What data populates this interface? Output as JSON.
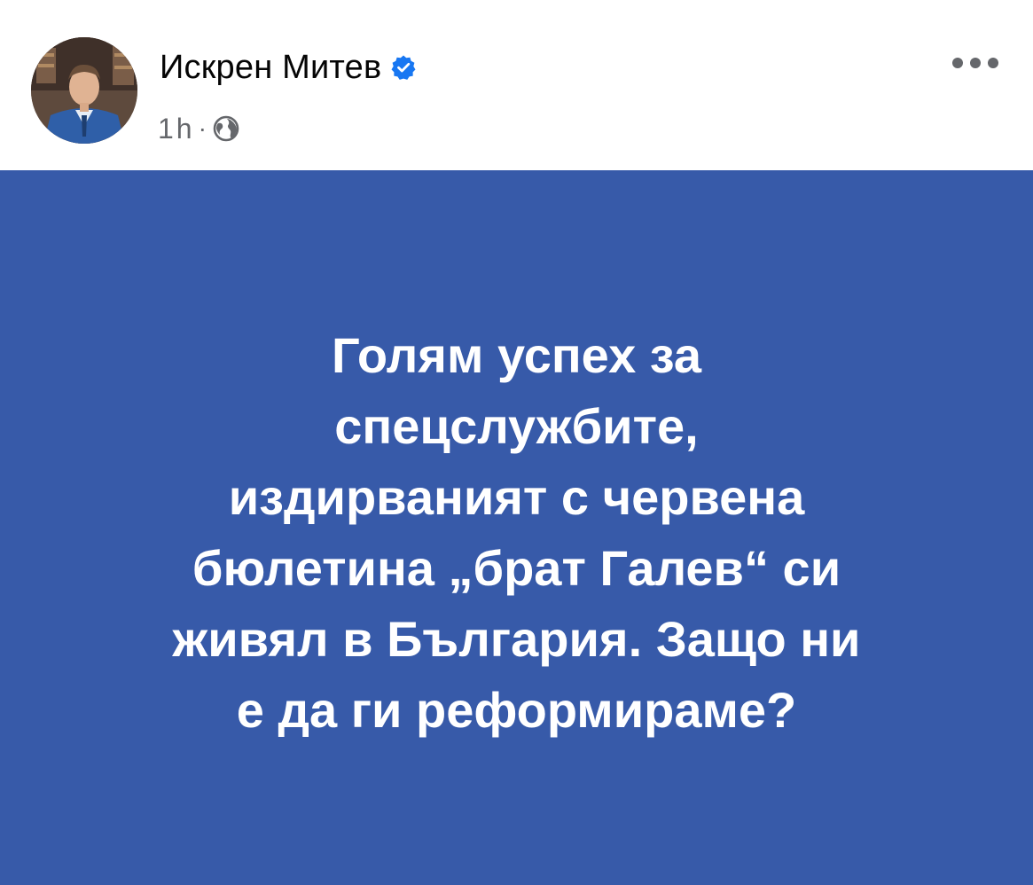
{
  "post": {
    "author": {
      "name": "Искрен Митев",
      "verified": true
    },
    "timestamp": "1h",
    "separator": "·",
    "audience_icon": "globe-icon",
    "more_icon": "more-horizontal-icon",
    "body": {
      "background_color": "#375aa9",
      "text_color": "#ffffff",
      "text": "Голям успех за\nспецслужбите,\nиздирваният с червена\nбюлетина „брат Галев“ си\nживял в България. Защо ни\nе да ги реформираме?"
    }
  },
  "colors": {
    "verified_badge": "#1877f2",
    "name_text": "#050505",
    "meta_text": "#65676b"
  }
}
